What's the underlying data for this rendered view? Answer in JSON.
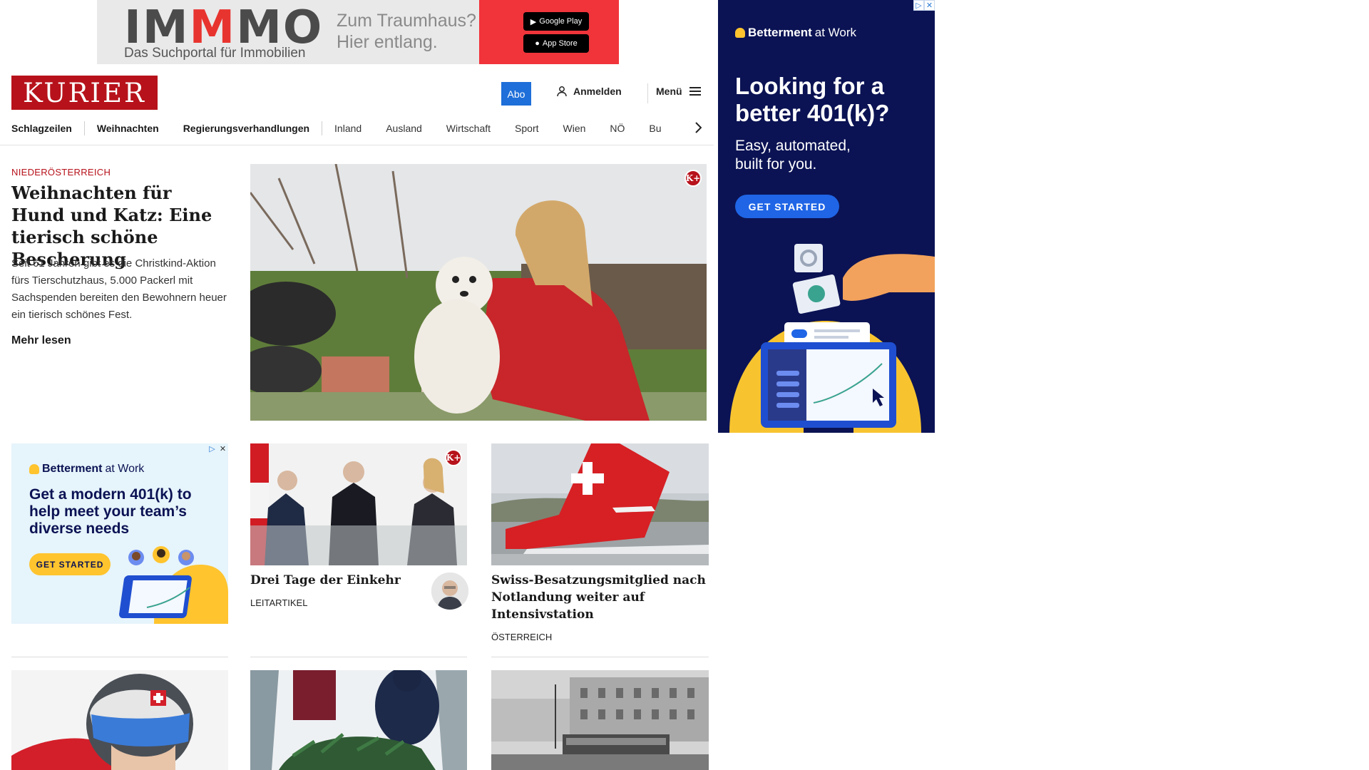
{
  "top_ad": {
    "brand_part1": "IM",
    "brand_part2": "M",
    "brand_part3": "MO",
    "tagline": "Das Suchportal für Immobilien",
    "claim_line1": "Zum Traumhaus?",
    "claim_line2": "Hier entlang.",
    "store1": "Google Play",
    "store2": "App Store"
  },
  "header": {
    "logo": "KURIER",
    "abo": "Abo",
    "login": "Anmelden",
    "menu": "Menü"
  },
  "nav": {
    "items": [
      "Schlagzeilen",
      "Weihnachten",
      "Regierungsverhandlungen",
      "Inland",
      "Ausland",
      "Wirtschaft",
      "Sport",
      "Wien",
      "NÖ",
      "Bu"
    ]
  },
  "lead": {
    "kicker": "NIEDERÖSTERREICH",
    "title": "Weihnachten für Hund und Katz: Eine tierisch schöne Bescherung",
    "teaser": "Seit 61 Jahren gibt es die Christkind-Aktion fürs Tierschutzhaus, 5.000 Packerl mit Sachspenden bereiten den Bewohnern heuer ein tierisch schönes Fest.",
    "more": "Mehr lesen",
    "badge": "K+"
  },
  "side_ad": {
    "brand": "Betterment",
    "brand_suffix": "at Work",
    "headline_line1": "Looking for a",
    "headline_line2": "better 401(k)?",
    "sub_line1": "Easy, automated,",
    "sub_line2": "built for you.",
    "cta": "GET STARTED"
  },
  "small_ad": {
    "brand": "Betterment",
    "brand_suffix": "at Work",
    "headline": "Get a modern 401(k) to help meet your team’s diverse needs",
    "cta": "GET STARTED"
  },
  "cards": [
    {
      "title": "Drei Tage der Einkehr",
      "kicker": "LEITARTIKEL",
      "badge": "K+"
    },
    {
      "title": "Swiss-Besatzungsmitglied nach Notlandung weiter auf Intensivstation",
      "kicker": "ÖSTERREICH"
    }
  ]
}
